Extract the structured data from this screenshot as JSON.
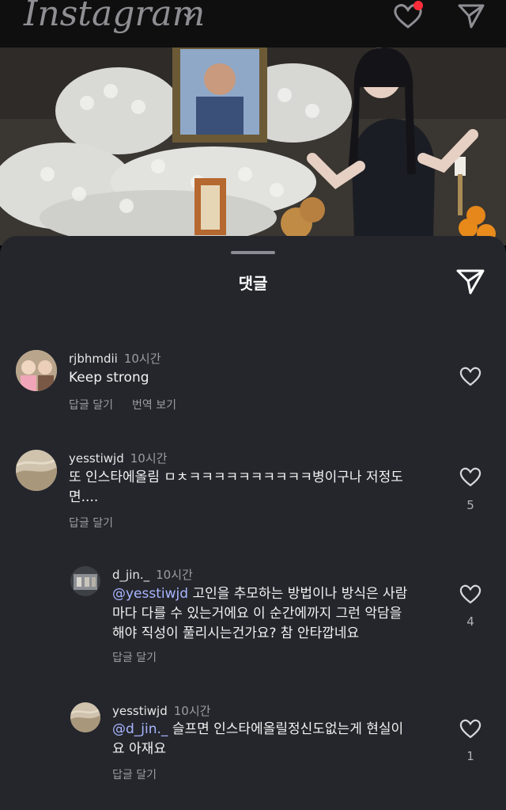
{
  "app": {
    "title": "Instagram"
  },
  "colors": {
    "sheet": "#24262c",
    "mention": "#a9b6ff",
    "notification": "#ff2d3b"
  },
  "icons": {
    "top_left": "chevron-down-icon",
    "top_heart": "heart-icon",
    "top_send": "send-icon",
    "like": "heart-outline-icon"
  },
  "sheet": {
    "title": "댓글"
  },
  "comments": [
    {
      "username": "rjbhmdii",
      "time": "10시간",
      "text": "Keep strong",
      "reply": "답글 달기",
      "translate": "번역 보기"
    },
    {
      "username": "yesstiwjd",
      "time": "10시간",
      "line1": "또 인스타에올림 ㅁㅊㅋㅋㅋㅋㅋㅋㅋㅋㅋㅋ병이구나 저정도",
      "line2": "면....",
      "reply": "답글 달기",
      "likes": "5"
    },
    {
      "username": "d_jin._",
      "time": "10시간",
      "mention": "@yesstiwjd",
      "line1": " 고인을 추모하는 방법이나 방식은 사람",
      "line2": "마다 다를 수 있는거에요 이 순간에까지 그런 악담을",
      "line3": "해야 직성이 풀리시는건가요? 참 안타깝네요",
      "reply": "답글 달기",
      "likes": "4"
    },
    {
      "username": "yesstiwjd",
      "time": "10시간",
      "mention": "@d_jin._",
      "line1": " 슬프면 인스타에올릴정신도없는게 현실이",
      "line2": "요 아재요",
      "reply": "답글 달기",
      "likes": "1"
    }
  ]
}
